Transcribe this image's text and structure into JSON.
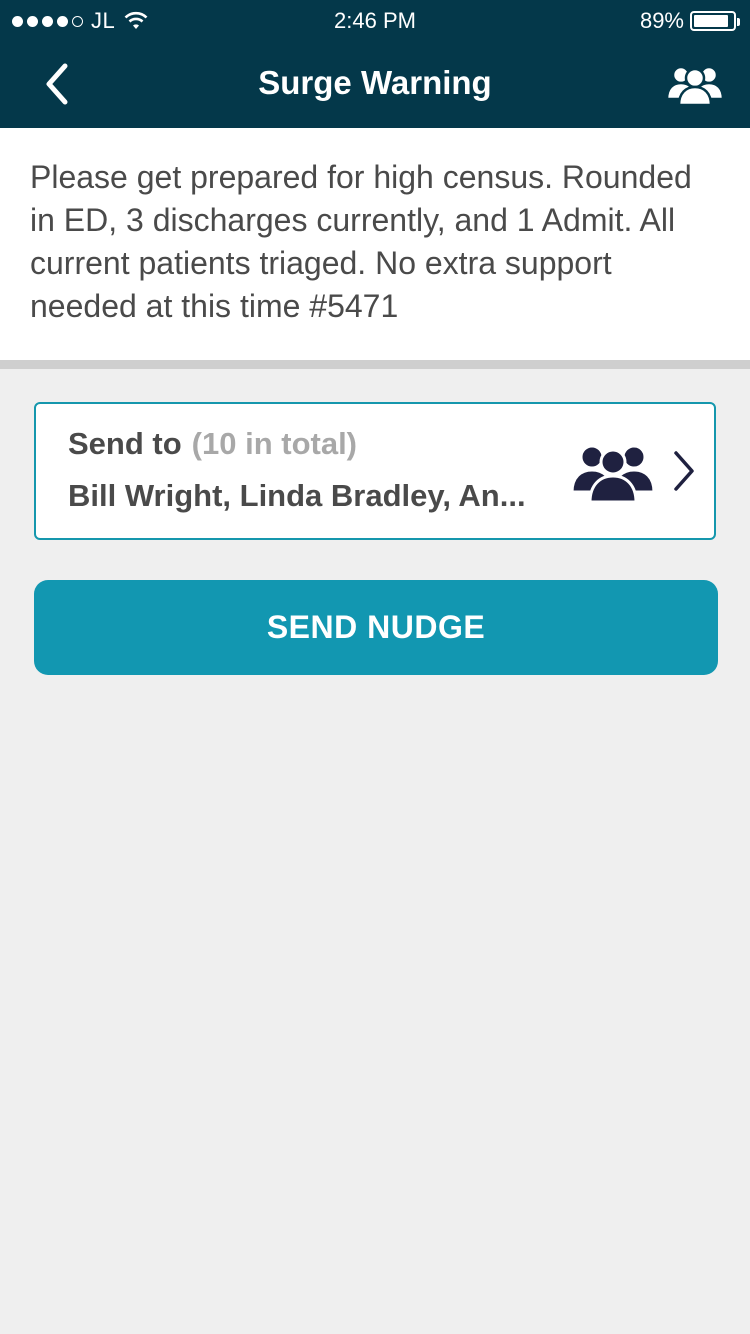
{
  "status_bar": {
    "carrier": "JL",
    "time": "2:46 PM",
    "battery_percent": "89%",
    "battery_level": 0.89,
    "signal_bars": 4,
    "signal_max": 5
  },
  "nav": {
    "title": "Surge Warning",
    "back_icon": "chevron-left-icon",
    "right_icon": "group-icon"
  },
  "message": {
    "text": "Please get prepared for high census. Rounded in ED, 3 discharges currently, and 1 Admit. All current patients triaged. No extra support needed at this time #5471"
  },
  "send_to": {
    "label": "Send to",
    "count_text": "(10 in total)",
    "recipients": "Bill Wright, Linda Bradley, An..."
  },
  "actions": {
    "send_label": "SEND NUDGE"
  },
  "colors": {
    "header_bg": "#04384a",
    "accent": "#1297b1",
    "card_border": "#1597ad",
    "icon_dark": "#1f2140",
    "background": "#efefef"
  }
}
